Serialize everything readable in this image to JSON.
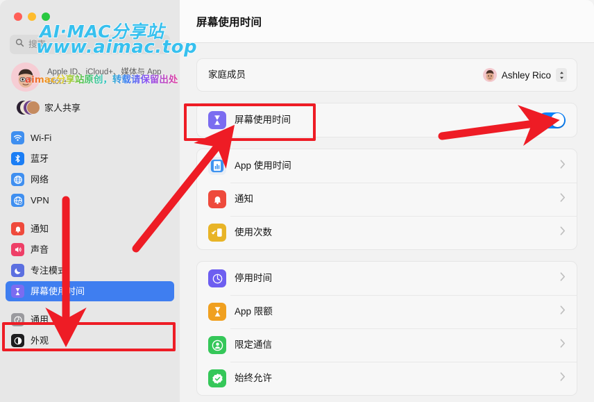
{
  "window": {
    "traffic_lights": [
      "close",
      "minimize",
      "zoom"
    ],
    "colors": {
      "accent_blue": "#3f7ef0",
      "toggle_on": "#0a84ff",
      "annotation_red": "#ee1c25",
      "sidebar_bg": "#e7e7e7",
      "main_bg": "#f2f2f2",
      "card_bg": "#f7f7f7"
    }
  },
  "sidebar": {
    "search": {
      "placeholder": "搜索",
      "value": "",
      "icon": "search-icon"
    },
    "account": {
      "name": "",
      "subtitle": "Apple ID、iCloud+、媒体与 App Store",
      "avatar": "memoji-avatar"
    },
    "family_sharing": {
      "label": "家人共享",
      "icon": "family-sharing-icon"
    },
    "groups": [
      {
        "items": [
          {
            "label": "Wi-Fi",
            "icon": "wifi-icon",
            "selected": false
          },
          {
            "label": "蓝牙",
            "icon": "bluetooth-icon",
            "selected": false
          },
          {
            "label": "网络",
            "icon": "network-globe-icon",
            "selected": false
          },
          {
            "label": "VPN",
            "icon": "vpn-globe-icon",
            "selected": false
          }
        ]
      },
      {
        "items": [
          {
            "label": "通知",
            "icon": "notifications-bell-icon",
            "selected": false
          },
          {
            "label": "声音",
            "icon": "sound-speaker-icon",
            "selected": false
          },
          {
            "label": "专注模式",
            "icon": "focus-moon-icon",
            "selected": false
          },
          {
            "label": "屏幕使用时间",
            "icon": "screen-time-hourglass-icon",
            "selected": true
          }
        ]
      },
      {
        "items": [
          {
            "label": "通用",
            "icon": "general-gear-icon",
            "selected": false
          },
          {
            "label": "外观",
            "icon": "appearance-contrast-icon",
            "selected": false
          }
        ]
      }
    ]
  },
  "main": {
    "title": "屏幕使用时间",
    "cards": [
      {
        "rows": [
          {
            "type": "popup",
            "label": "家庭成员",
            "value": "Ashley Rico",
            "avatar": "member-avatar",
            "control": "popup-chevron-icon"
          }
        ]
      },
      {
        "rows": [
          {
            "type": "toggle",
            "label": "屏幕使用时间",
            "icon": "screen-time-hourglass-icon",
            "toggle_on": true
          }
        ]
      },
      {
        "rows": [
          {
            "type": "disclosure",
            "label": "App 使用时间",
            "icon": "app-usage-chart-icon"
          },
          {
            "type": "disclosure",
            "label": "通知",
            "icon": "notifications-bell-icon"
          },
          {
            "type": "disclosure",
            "label": "使用次数",
            "icon": "pickups-device-icon"
          }
        ]
      },
      {
        "rows": [
          {
            "type": "disclosure",
            "label": "停用时间",
            "icon": "downtime-clock-icon"
          },
          {
            "type": "disclosure",
            "label": "App 限额",
            "icon": "app-limits-hourglass-icon"
          },
          {
            "type": "disclosure",
            "label": "限定通信",
            "icon": "communication-limits-person-icon"
          },
          {
            "type": "disclosure",
            "label": "始终允许",
            "icon": "always-allowed-check-icon"
          }
        ]
      }
    ]
  },
  "annotations": {
    "rects": [
      {
        "name": "screen-time-row-highlight"
      },
      {
        "name": "sidebar-screen-time-highlight"
      }
    ],
    "arrows": [
      {
        "name": "arrow-to-sidebar-screen-time",
        "direction": "down"
      },
      {
        "name": "arrow-to-screen-time-row",
        "direction": "up-right"
      },
      {
        "name": "arrow-to-toggle",
        "direction": "right"
      }
    ]
  },
  "watermark": {
    "line1": "AI·MAC分享站",
    "line2": "www.aimac.top",
    "line3": "aimac分享站原创，转载请保留出处"
  }
}
